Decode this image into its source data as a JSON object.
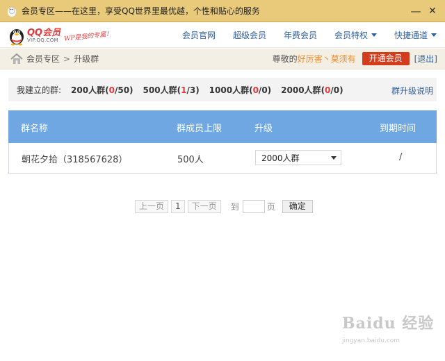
{
  "window": {
    "title": "会员专区——在这里，享受QQ世界里最优越，个性和贴心的服务",
    "minimize": "—",
    "close": "✕"
  },
  "brand": {
    "name": "QQ会员",
    "url": "VIP.QQ.COM",
    "slogan": "WP是我的专属！"
  },
  "nav": [
    {
      "label": "会员官网",
      "has_menu": false
    },
    {
      "label": "超级会员",
      "has_menu": false
    },
    {
      "label": "年费会员",
      "has_menu": false
    },
    {
      "label": "会员特权",
      "has_menu": true
    },
    {
      "label": "快捷通道",
      "has_menu": true
    }
  ],
  "breadcrumb": {
    "root": "会员专区",
    "separator": ">",
    "current": "升级群"
  },
  "user": {
    "greeting": "尊敬的",
    "name": "好厉害丶莫须有",
    "open_vip": "开通会员",
    "logout": "[退出]"
  },
  "summary": {
    "label": "我建立的群:",
    "groups": [
      {
        "name": "200人群",
        "used": "0",
        "total": "50"
      },
      {
        "name": "500人群",
        "used": "1",
        "total": "3"
      },
      {
        "name": "1000人群",
        "used": "0",
        "total": "0"
      },
      {
        "name": "2000人群",
        "used": "0",
        "total": "0"
      }
    ],
    "help": "群升级说明"
  },
  "table": {
    "headers": [
      "群名称",
      "群成员上限",
      "升级",
      "到期时间"
    ],
    "rows": [
      {
        "name": "朝花夕拾（318567628）",
        "limit": "500人",
        "upgrade": "2000人群",
        "expires": "/"
      }
    ]
  },
  "pager": {
    "prev": "上一页",
    "page": "1",
    "next": "下一页",
    "goto": "到",
    "page_value": "",
    "unit": "页",
    "confirm": "确定"
  },
  "watermark": {
    "logo": "Baidu 经验",
    "url": "jingyan.baidu.com"
  },
  "colors": {
    "titlebar": "#e9c97a",
    "table_header": "#6fa7e2",
    "accent_red": "#e4393c",
    "link_blue": "#2f5fa0",
    "username_orange": "#ef8a24"
  }
}
